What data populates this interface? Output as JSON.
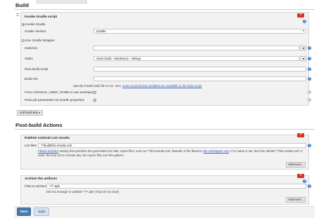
{
  "build": {
    "section_title": "Build",
    "gradle_panel": {
      "title": "Invoke Gradle script",
      "invoke_gradle_label": "Invoke Gradle",
      "gradle_version_label": "Gradle Version",
      "gradle_version_value": "Gradle",
      "use_wrapper_label": "Use Gradle Wrapper",
      "switches_label": "Switches",
      "switches_value": "",
      "tasks_label": "Tasks",
      "tasks_value": "clean build --stacktrace --debug",
      "root_build_script_label": "Root Build script",
      "root_build_script_value": "",
      "build_file_label": "Build File",
      "build_file_value": "",
      "build_file_hint_prefix": "Specify Gradle build file to run. Also,",
      "build_file_hint_link": "some environment variables are available to the build script",
      "force_home_label": "Force GRADLE_USER_HOME to use workspace",
      "pass_params_label": "Pass job parameters as Gradle properties"
    },
    "add_build_step_label": "Add build step ▾"
  },
  "post_build": {
    "section_title": "Post-build Actions",
    "lint_panel": {
      "title": "Publish Android Lint results",
      "lint_files_label": "Lint files",
      "lint_files_value": "**/build/lint-results.xml",
      "desc_link1": "Fileset includes",
      "desc_text1": "setting that specifies the generated Lint XML report files, such as '**/lint-results.xml'. Basedir of the fileset is",
      "desc_link2": "the workspace root",
      "desc_text2": ". If no value is set, then the default '**/lint-results.xml' is",
      "desc_line2": "used. Be sure not to include any non-report files into this pattern.",
      "advanced_label": "Advanced..."
    },
    "archive_panel": {
      "title": "Archive the artifacts",
      "files_label": "Files to archive",
      "files_value": "**/*.apk",
      "warning": "Did not manage to validate '**/*.apk' (may be too slow)",
      "advanced_label": "Advanced..."
    }
  },
  "footer": {
    "save_label": "Save",
    "apply_label": "Apply"
  }
}
